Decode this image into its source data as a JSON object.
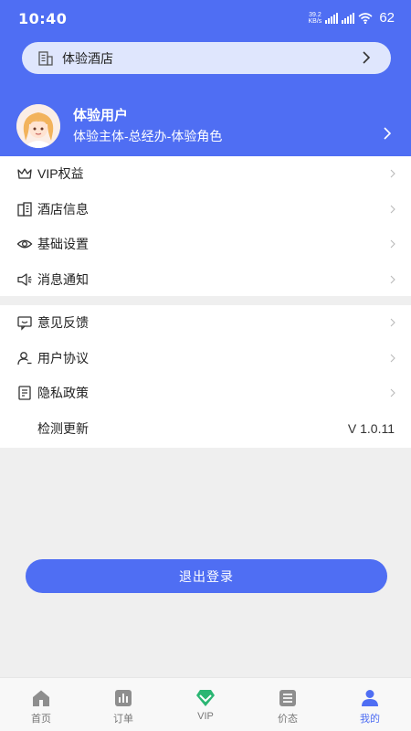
{
  "status_bar": {
    "time": "10:40",
    "net_speed_value": "39.2",
    "net_speed_unit": "KB/s",
    "battery": "62"
  },
  "hotel_selector": {
    "name": "体验酒店"
  },
  "user": {
    "name": "体验用户",
    "role": "体验主体-总经办-体验角色"
  },
  "menu_group_1": [
    {
      "label": "VIP权益",
      "icon": "crown-icon"
    },
    {
      "label": "酒店信息",
      "icon": "building-icon"
    },
    {
      "label": "基础设置",
      "icon": "eye-icon"
    },
    {
      "label": "消息通知",
      "icon": "speaker-icon"
    }
  ],
  "menu_group_2": [
    {
      "label": "意见反馈",
      "icon": "feedback-icon"
    },
    {
      "label": "用户协议",
      "icon": "user-icon"
    },
    {
      "label": "隐私政策",
      "icon": "document-icon"
    },
    {
      "label": "检测更新",
      "icon": "",
      "value": "V 1.0.11"
    }
  ],
  "logout_label": "退出登录",
  "tabs": [
    {
      "label": "首页",
      "icon": "home-icon",
      "active": false
    },
    {
      "label": "订单",
      "icon": "orders-icon",
      "active": false
    },
    {
      "label": "VIP",
      "icon": "vip-icon",
      "active": false
    },
    {
      "label": "价态",
      "icon": "list-icon",
      "active": false
    },
    {
      "label": "我的",
      "icon": "profile-icon",
      "active": true
    }
  ],
  "colors": {
    "primary": "#4f6ef3",
    "pill_bg": "#dfe6fd",
    "background": "#efefef",
    "vip_green": "#2bb673"
  }
}
